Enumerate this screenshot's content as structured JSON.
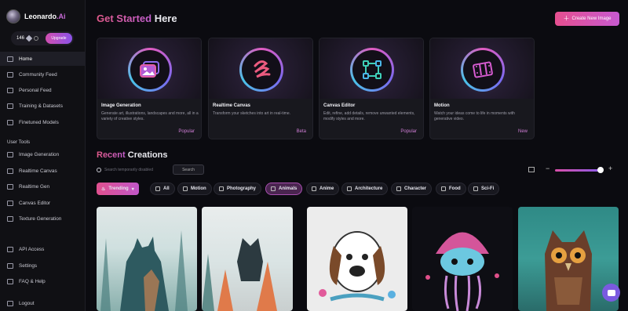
{
  "brand": {
    "name": "Leonardo",
    "suffix": ".Ai"
  },
  "account": {
    "credits": "146",
    "upgrade_label": "Upgrade"
  },
  "sidebar": {
    "items": [
      {
        "label": "Home",
        "icon": "home-icon",
        "active": true
      },
      {
        "label": "Community Feed",
        "icon": "community-icon"
      },
      {
        "label": "Personal Feed",
        "icon": "personal-feed-icon"
      },
      {
        "label": "Training & Datasets",
        "icon": "training-icon"
      },
      {
        "label": "Finetuned Models",
        "icon": "models-icon"
      }
    ],
    "tools_heading": "User Tools",
    "tools": [
      {
        "label": "Image Generation",
        "icon": "image-icon"
      },
      {
        "label": "Realtime Canvas",
        "icon": "canvas-icon"
      },
      {
        "label": "Realtime Gen",
        "icon": "realtime-gen-icon"
      },
      {
        "label": "Canvas Editor",
        "icon": "editor-icon"
      },
      {
        "label": "Texture Generation",
        "icon": "texture-icon"
      }
    ],
    "footer": [
      {
        "label": "API Access",
        "icon": "api-icon"
      },
      {
        "label": "Settings",
        "icon": "gear-icon"
      },
      {
        "label": "FAQ & Help",
        "icon": "help-icon"
      },
      {
        "label": "Logout",
        "icon": "logout-icon"
      }
    ]
  },
  "header": {
    "title_accent": "Get Started",
    "title_rest": " Here",
    "create_label": "Create New Image"
  },
  "features": [
    {
      "title": "Image Generation",
      "desc": "Generate art, illustrations, landscapes and more, all in a variety of creative styles.",
      "tag": "Popular",
      "icon": "image-generation-icon"
    },
    {
      "title": "Realtime Canvas",
      "desc": "Transform your sketches into art in real-time.",
      "tag": "Beta",
      "icon": "squiggle-icon"
    },
    {
      "title": "Canvas Editor",
      "desc": "Edit, refine, add details, remove unwanted elements, modify styles and more.",
      "tag": "Popular",
      "icon": "canvas-editor-icon"
    },
    {
      "title": "Motion",
      "desc": "Watch your ideas come to life in moments with generative video.",
      "tag": "New",
      "icon": "film-icon"
    }
  ],
  "recent": {
    "title_accent": "Recent",
    "title_rest": " Creations",
    "search_placeholder": "Search temporarily disabled",
    "search_button": "Search"
  },
  "filters": [
    {
      "label": "Trending",
      "icon": "flame-icon"
    },
    {
      "label": "All",
      "icon": "grid-icon"
    },
    {
      "label": "Motion",
      "icon": "film-icon"
    },
    {
      "label": "Photography",
      "icon": "camera-icon"
    },
    {
      "label": "Animals",
      "icon": "paw-icon",
      "selected": true
    },
    {
      "label": "Anime",
      "icon": "anime-icon"
    },
    {
      "label": "Architecture",
      "icon": "building-icon"
    },
    {
      "label": "Character",
      "icon": "character-icon"
    },
    {
      "label": "Food",
      "icon": "food-icon"
    },
    {
      "label": "Sci-Fi",
      "icon": "scifi-icon"
    }
  ],
  "gallery": [
    {
      "subject": "wolf-forest-double-exposure"
    },
    {
      "subject": "cat-forest-double-exposure"
    },
    {
      "subject": "beagle-sticker"
    },
    {
      "subject": "jellyfish-character"
    },
    {
      "subject": "owl-painting"
    }
  ]
}
